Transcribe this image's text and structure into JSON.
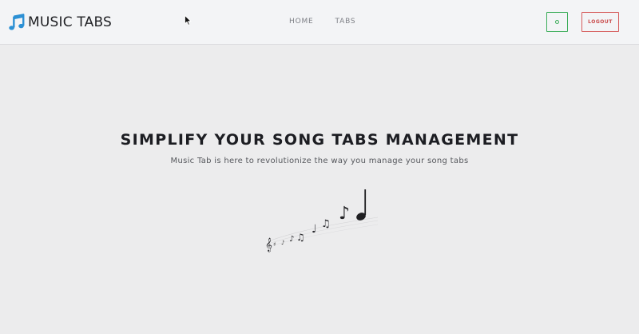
{
  "header": {
    "brand": "MUSIC TABS",
    "brand_icon": "music-note-icon",
    "nav": [
      {
        "label": "HOME"
      },
      {
        "label": "TABS"
      }
    ],
    "toggle_icon": "circle-icon",
    "logout_label": "LOGOUT"
  },
  "hero": {
    "title": "SIMPLIFY YOUR SONG TABS MANAGEMENT",
    "subtitle": "Music Tab is here to revolutionize the way you manage your song tabs",
    "illustration": "flowing-music-notes-icon"
  },
  "colors": {
    "brand_accent": "#2a8fd4",
    "toggle_border": "#3cad5a",
    "logout_border": "#d65c5c",
    "background": "#ececed"
  }
}
